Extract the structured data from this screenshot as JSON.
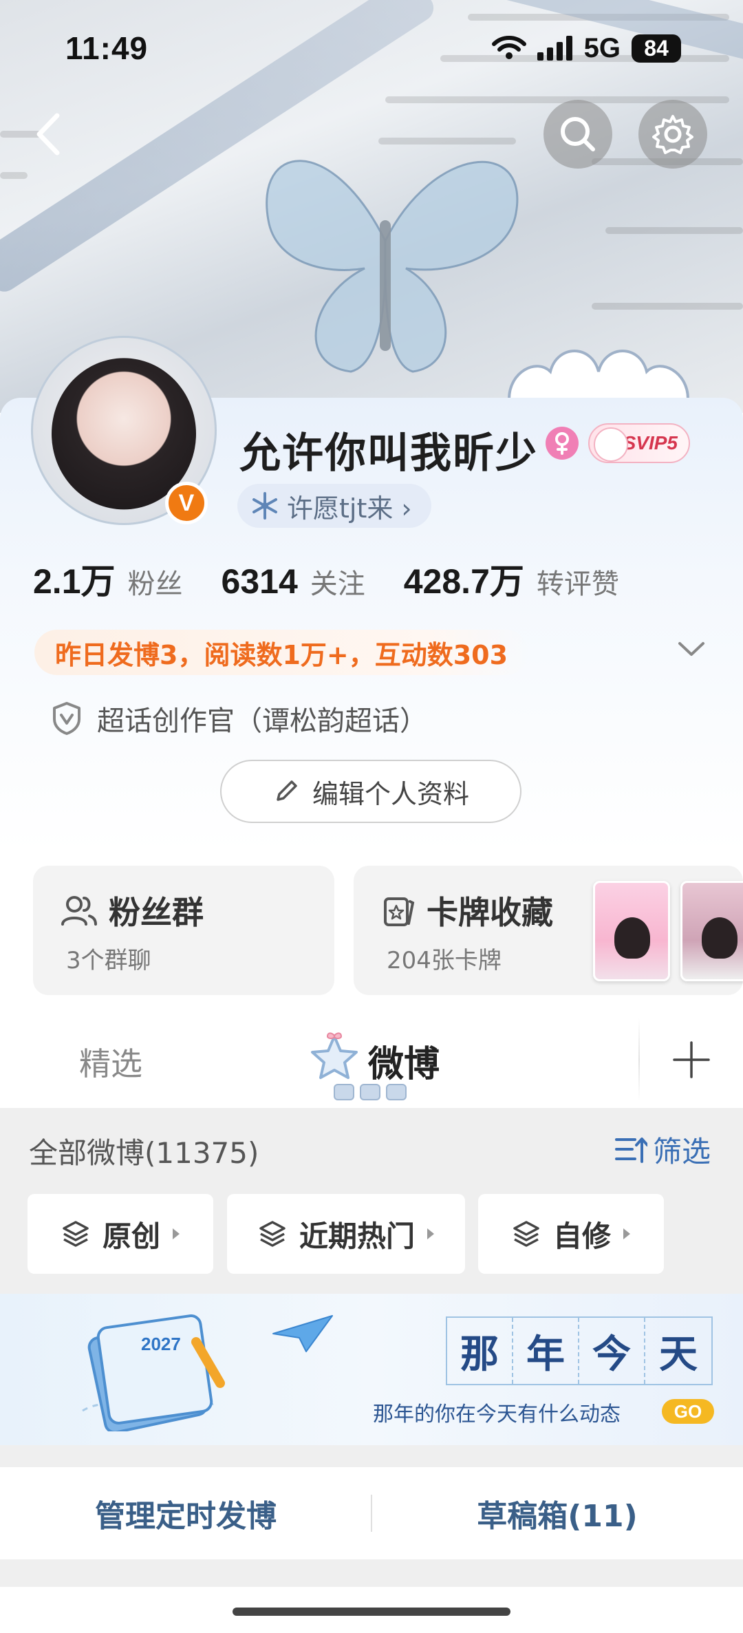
{
  "status_bar": {
    "time": "11:49",
    "network": "5G",
    "battery": "84"
  },
  "nav": {
    "back_icon": "chevron-left-icon",
    "search_icon": "search-icon",
    "settings_icon": "gear-icon"
  },
  "profile": {
    "username": "允许你叫我昕少",
    "gender": "female",
    "svip_label": "SVIP5",
    "verified_badge": "V",
    "wish_chip": "许愿tjt来 ›",
    "stats": [
      {
        "value": "2.1万",
        "label": "粉丝"
      },
      {
        "value": "6314",
        "label": "关注"
      },
      {
        "value": "428.7万",
        "label": "转评赞"
      }
    ],
    "activity_summary": "昨日发博3，阅读数1万+，互动数303",
    "supertopic_title": "超话创作官（谭松韵超话）",
    "edit_button": "编辑个人资料"
  },
  "cards": {
    "fans_group": {
      "title": "粉丝群",
      "subtitle": "3个群聊"
    },
    "card_collection": {
      "title": "卡牌收藏",
      "subtitle": "204张卡牌"
    }
  },
  "tabs": {
    "featured": "精选",
    "weibo": "微博"
  },
  "filter": {
    "all_weibo": "全部微博(11375)",
    "filter_label": "筛选",
    "chips": [
      "原创",
      "近期热门",
      "自修"
    ]
  },
  "banner": {
    "calendar_year": "2027",
    "title_chars": [
      "那",
      "年",
      "今",
      "天"
    ],
    "subtitle": "那年的你在今天有什么动态",
    "go_label": "GO"
  },
  "actions": {
    "scheduled": "管理定时发博",
    "drafts": "草稿箱(11)"
  },
  "colors": {
    "accent_orange": "#ef6b1e",
    "link_blue": "#3a6fb5",
    "action_blue": "#3a5f88",
    "go_yellow": "#f5b822"
  }
}
